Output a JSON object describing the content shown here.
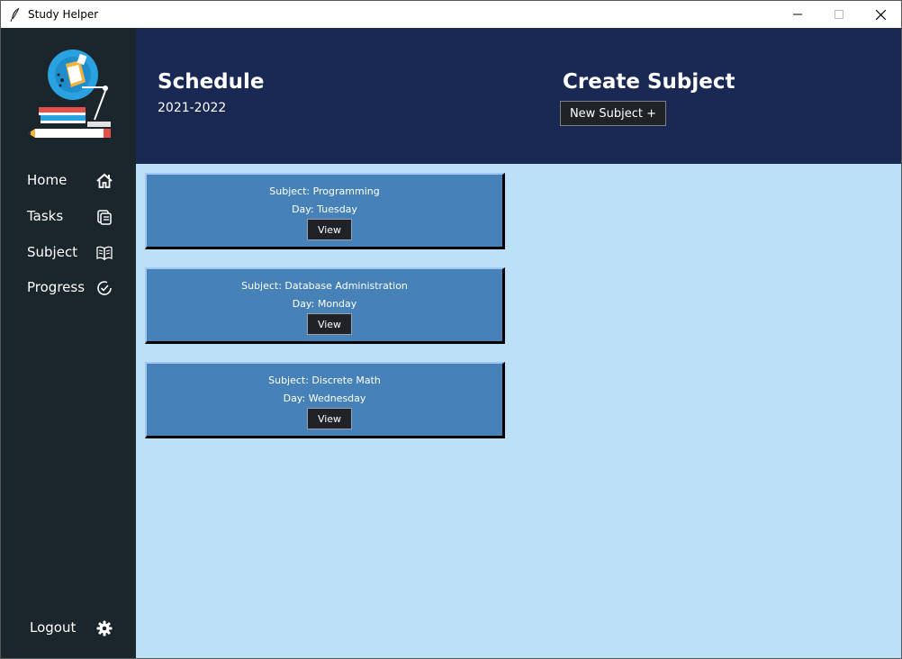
{
  "window": {
    "title": "Study Helper",
    "controls": [
      "minimize-icon",
      "maximize-icon",
      "close-icon"
    ]
  },
  "sidebar": {
    "logo": "study-logo-icon",
    "items": [
      {
        "label": "Home",
        "icon": "home-icon"
      },
      {
        "label": "Tasks",
        "icon": "tasks-icon"
      },
      {
        "label": "Subject",
        "icon": "book-icon"
      },
      {
        "label": "Progress",
        "icon": "progress-check-icon"
      }
    ],
    "logout": {
      "label": "Logout",
      "icon": "gear-icon"
    }
  },
  "header": {
    "schedule_title": "Schedule",
    "schedule_year": "2021-2022",
    "create_title": "Create Subject",
    "new_subject_label": "New Subject +"
  },
  "cards": [
    {
      "subject": "Subject: Programming",
      "day": "Day: Tuesday",
      "button": "View"
    },
    {
      "subject": "Subject: Database Administration",
      "day": "Day: Monday",
      "button": "View"
    },
    {
      "subject": "Subject: Discrete Math",
      "day": "Day: Wednesday",
      "button": "View"
    }
  ],
  "colors": {
    "sidebar_bg": "#1b252c",
    "header_bg": "#1a2953",
    "content_bg": "#bbe0f8",
    "card_bg": "#4682b8",
    "button_bg": "#1f2327"
  }
}
